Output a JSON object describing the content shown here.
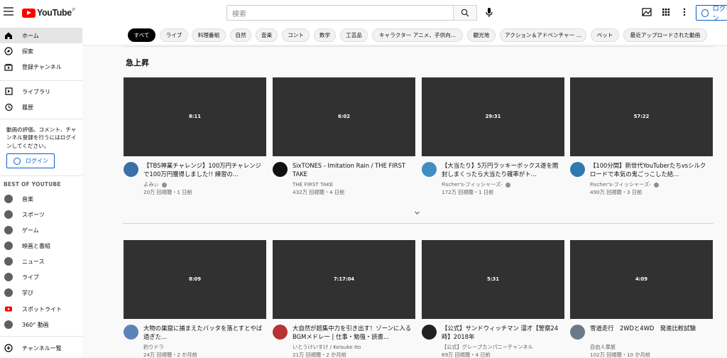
{
  "header": {
    "logo_text": "YouTube",
    "logo_country": "JP",
    "search_placeholder": "検索",
    "login_label": "ログイン"
  },
  "sidebar": {
    "items": [
      {
        "label": "ホーム",
        "icon": "home-icon"
      },
      {
        "label": "探索",
        "icon": "explore-icon"
      },
      {
        "label": "登録チャンネル",
        "icon": "subscriptions-icon"
      },
      {
        "label": "ライブラリ",
        "icon": "library-icon"
      },
      {
        "label": "履歴",
        "icon": "history-icon"
      }
    ],
    "signin_message": "動画の評価、コメント、チャンネル登録を行うにはログインしてください。",
    "login_label": "ログイン",
    "best_heading": "BEST OF YOUTUBE",
    "best_items": [
      {
        "label": "音楽",
        "icon": "music-icon"
      },
      {
        "label": "スポーツ",
        "icon": "sports-icon"
      },
      {
        "label": "ゲーム",
        "icon": "gaming-icon"
      },
      {
        "label": "映画と番組",
        "icon": "movies-icon"
      },
      {
        "label": "ニュース",
        "icon": "news-icon"
      },
      {
        "label": "ライブ",
        "icon": "live-icon"
      },
      {
        "label": "学び",
        "icon": "learning-icon"
      },
      {
        "label": "スポットライト",
        "icon": "spotlight-icon"
      },
      {
        "label": "360° 動画",
        "icon": "vr-icon"
      }
    ],
    "browse_channels": "チャンネル一覧"
  },
  "chips": [
    "すべて",
    "ライブ",
    "料理番組",
    "自然",
    "音楽",
    "コント",
    "数学",
    "工芸品",
    "キャラクター アニメ、子供向...",
    "観光地",
    "アクション＆アドベンチャー ...",
    "ペット",
    "最近アップロードされた動画"
  ],
  "section_title": "急上昇",
  "videos": [
    {
      "duration": "8:11",
      "title": "【TBS神業チャレンジ】100万円チャレンジで100万円獲得しました!! 練習の...",
      "channel": "よみぃ",
      "verified": true,
      "meta": "20万 回視聴・1 日前"
    },
    {
      "duration": "6:02",
      "title": "SixTONES - Imitation Rain / THE FIRST TAKE",
      "channel": "THE FIRST TAKE",
      "verified": false,
      "meta": "432万 回視聴・4 日前"
    },
    {
      "duration": "29:31",
      "title": "【大当たり】5万円ラッキーボックス遂を開封しまくったら大当たり確率がト...",
      "channel": "Fischer's-フィッシャーズ-",
      "verified": true,
      "meta": "172万 回視聴・1 日前"
    },
    {
      "duration": "57:22",
      "title": "【100分間】新世代YouTuberたちvsシルクロードで本気の鬼ごっこした結...",
      "channel": "Fischer's-フィッシャーズ-",
      "verified": true,
      "meta": "490万 回視聴・3 日前"
    },
    {
      "duration": "8:09",
      "title": "大物の巣窟に捕まえたバッタを落とすとやば過ぎた...",
      "channel": "釣りドラ",
      "verified": false,
      "meta": "24万 回視聴・2 か月前"
    },
    {
      "duration": "7:17:04",
      "title": "大自然が超集中力を引き出す！ゾーンに入るBGMメドレー | 仕事・勉強・読書...",
      "channel": "いとうけいすけ / Keisuke Ito",
      "verified": false,
      "meta": "21万 回視聴・2 か月前"
    },
    {
      "duration": "5:31",
      "title": "【公式】サンドウィッチマン 漫才【警察24時】2018年",
      "channel": "【公式】グレープカンパニーチャンネル",
      "verified": false,
      "meta": "69万 回視聴・4 日前"
    },
    {
      "duration": "4:09",
      "title": "雪道走行　2WDと4WD　発進比較試験",
      "channel": "自由人車旅",
      "verified": false,
      "meta": "102万 回視聴・10 か月前"
    }
  ],
  "colors": {
    "brand": "#ff0000",
    "link": "#065fd4",
    "thumb": "#313131",
    "chip_active": "#030303"
  }
}
